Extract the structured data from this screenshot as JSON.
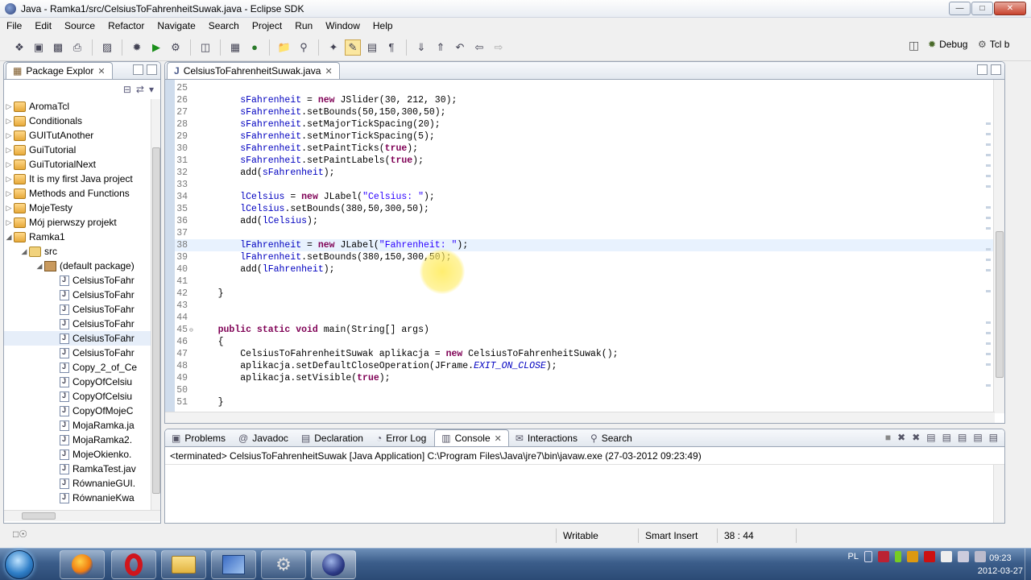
{
  "window": {
    "title": "Java - Ramka1/src/CelsiusToFahrenheitSuwak.java - Eclipse SDK"
  },
  "menu": [
    "File",
    "Edit",
    "Source",
    "Refactor",
    "Navigate",
    "Search",
    "Project",
    "Run",
    "Window",
    "Help"
  ],
  "perspectives": {
    "debug": "Debug",
    "tcl": "Tcl b"
  },
  "package_explorer": {
    "title": "Package Explor",
    "items": [
      {
        "label": "AromaTcl",
        "type": "project",
        "indent": 0
      },
      {
        "label": "Conditionals",
        "type": "project",
        "indent": 0
      },
      {
        "label": "GUITutAnother",
        "type": "project",
        "indent": 0
      },
      {
        "label": "GuiTutorial",
        "type": "project",
        "indent": 0
      },
      {
        "label": "GuiTutorialNext",
        "type": "project",
        "indent": 0
      },
      {
        "label": "It is my first Java project",
        "type": "project",
        "indent": 0
      },
      {
        "label": "Methods and Functions",
        "type": "project",
        "indent": 0
      },
      {
        "label": "MojeTesty",
        "type": "project",
        "indent": 0
      },
      {
        "label": "Mój pierwszy projekt",
        "type": "project",
        "indent": 0
      },
      {
        "label": "Ramka1",
        "type": "project",
        "indent": 0,
        "expanded": true
      },
      {
        "label": "src",
        "type": "src",
        "indent": 1,
        "expanded": true
      },
      {
        "label": "(default package)",
        "type": "package",
        "indent": 2,
        "expanded": true
      },
      {
        "label": "CelsiusToFahr",
        "type": "java",
        "indent": 3
      },
      {
        "label": "CelsiusToFahr",
        "type": "java",
        "indent": 3
      },
      {
        "label": "CelsiusToFahr",
        "type": "java",
        "indent": 3
      },
      {
        "label": "CelsiusToFahr",
        "type": "java",
        "indent": 3
      },
      {
        "label": "CelsiusToFahr",
        "type": "java",
        "indent": 3,
        "selected": true
      },
      {
        "label": "CelsiusToFahr",
        "type": "java",
        "indent": 3
      },
      {
        "label": "Copy_2_of_Ce",
        "type": "java",
        "indent": 3
      },
      {
        "label": "CopyOfCelsiu",
        "type": "java",
        "indent": 3
      },
      {
        "label": "CopyOfCelsiu",
        "type": "java",
        "indent": 3
      },
      {
        "label": "CopyOfMojeC",
        "type": "java",
        "indent": 3
      },
      {
        "label": "MojaRamka.ja",
        "type": "java",
        "indent": 3
      },
      {
        "label": "MojaRamka2.",
        "type": "java",
        "indent": 3
      },
      {
        "label": "MojeOkienko.",
        "type": "java",
        "indent": 3
      },
      {
        "label": "RamkaTest.jav",
        "type": "java",
        "indent": 3
      },
      {
        "label": "RównanieGUI.",
        "type": "java",
        "indent": 3
      },
      {
        "label": "RównanieKwa",
        "type": "java",
        "indent": 3
      }
    ]
  },
  "editor": {
    "tab": "CelsiusToFahrenheitSuwak.java",
    "current_line": 38,
    "lines": [
      {
        "n": "25",
        "tokens": []
      },
      {
        "n": "26",
        "tokens": [
          [
            "",
            "        "
          ],
          [
            "fld",
            "sFahrenheit"
          ],
          [
            "",
            " = "
          ],
          [
            "kw",
            "new"
          ],
          [
            "",
            " JSlider(30, 212, 30);"
          ]
        ]
      },
      {
        "n": "27",
        "tokens": [
          [
            "",
            "        "
          ],
          [
            "fld",
            "sFahrenheit"
          ],
          [
            "",
            ".setBounds(50,150,300,50);"
          ]
        ]
      },
      {
        "n": "28",
        "tokens": [
          [
            "",
            "        "
          ],
          [
            "fld",
            "sFahrenheit"
          ],
          [
            "",
            ".setMajorTickSpacing(20);"
          ]
        ]
      },
      {
        "n": "29",
        "tokens": [
          [
            "",
            "        "
          ],
          [
            "fld",
            "sFahrenheit"
          ],
          [
            "",
            ".setMinorTickSpacing(5);"
          ]
        ]
      },
      {
        "n": "30",
        "tokens": [
          [
            "",
            "        "
          ],
          [
            "fld",
            "sFahrenheit"
          ],
          [
            "",
            ".setPaintTicks("
          ],
          [
            "kw",
            "true"
          ],
          [
            "",
            ");"
          ]
        ]
      },
      {
        "n": "31",
        "tokens": [
          [
            "",
            "        "
          ],
          [
            "fld",
            "sFahrenheit"
          ],
          [
            "",
            ".setPaintLabels("
          ],
          [
            "kw",
            "true"
          ],
          [
            "",
            ");"
          ]
        ]
      },
      {
        "n": "32",
        "tokens": [
          [
            "",
            "        add("
          ],
          [
            "fld",
            "sFahrenheit"
          ],
          [
            "",
            ");"
          ]
        ]
      },
      {
        "n": "33",
        "tokens": []
      },
      {
        "n": "34",
        "tokens": [
          [
            "",
            "        "
          ],
          [
            "fld",
            "lCelsius"
          ],
          [
            "",
            " = "
          ],
          [
            "kw",
            "new"
          ],
          [
            "",
            " JLabel("
          ],
          [
            "str",
            "\"Celsius: \""
          ],
          [
            "",
            ");"
          ]
        ]
      },
      {
        "n": "35",
        "tokens": [
          [
            "",
            "        "
          ],
          [
            "fld",
            "lCelsius"
          ],
          [
            "",
            ".setBounds(380,50,300,50);"
          ]
        ]
      },
      {
        "n": "36",
        "tokens": [
          [
            "",
            "        add("
          ],
          [
            "fld",
            "lCelsius"
          ],
          [
            "",
            ");"
          ]
        ]
      },
      {
        "n": "37",
        "tokens": []
      },
      {
        "n": "38",
        "tokens": [
          [
            "",
            "        "
          ],
          [
            "fld",
            "lFahrenheit"
          ],
          [
            "",
            " = "
          ],
          [
            "kw",
            "new"
          ],
          [
            "",
            " JLabel("
          ],
          [
            "str",
            "\"Fahrenheit: \""
          ],
          [
            "",
            ");"
          ]
        ]
      },
      {
        "n": "39",
        "tokens": [
          [
            "",
            "        "
          ],
          [
            "fld",
            "lFahrenheit"
          ],
          [
            "",
            ".setBounds(380,150,300,50);"
          ]
        ]
      },
      {
        "n": "40",
        "tokens": [
          [
            "",
            "        add("
          ],
          [
            "fld",
            "lFahrenheit"
          ],
          [
            "",
            ");"
          ]
        ]
      },
      {
        "n": "41",
        "tokens": []
      },
      {
        "n": "42",
        "tokens": [
          [
            "",
            "    }"
          ]
        ]
      },
      {
        "n": "43",
        "tokens": []
      },
      {
        "n": "44",
        "tokens": []
      },
      {
        "n": "45",
        "fold": true,
        "tokens": [
          [
            "",
            "    "
          ],
          [
            "kw",
            "public static void"
          ],
          [
            "",
            " main(String[] args)"
          ]
        ]
      },
      {
        "n": "46",
        "tokens": [
          [
            "",
            "    {"
          ]
        ]
      },
      {
        "n": "47",
        "tokens": [
          [
            "",
            "        CelsiusToFahrenheitSuwak aplikacja = "
          ],
          [
            "kw",
            "new"
          ],
          [
            "",
            " CelsiusToFahrenheitSuwak();"
          ]
        ]
      },
      {
        "n": "48",
        "tokens": [
          [
            "",
            "        aplikacja.setDefaultCloseOperation(JFrame."
          ],
          [
            "stat",
            "EXIT_ON_CLOSE"
          ],
          [
            "",
            ");"
          ]
        ]
      },
      {
        "n": "49",
        "tokens": [
          [
            "",
            "        aplikacja.setVisible("
          ],
          [
            "kw",
            "true"
          ],
          [
            "",
            ");"
          ]
        ]
      },
      {
        "n": "50",
        "tokens": []
      },
      {
        "n": "51",
        "tokens": [
          [
            "",
            "    }"
          ]
        ]
      }
    ]
  },
  "bottom_tabs": [
    "Problems",
    "Javadoc",
    "Declaration",
    "Error Log",
    "Console",
    "Interactions",
    "Search"
  ],
  "active_bottom_tab": "Console",
  "console": {
    "header": "<terminated> CelsiusToFahrenheitSuwak [Java Application] C:\\Program Files\\Java\\jre7\\bin\\javaw.exe (27-03-2012 09:23:49)"
  },
  "status": {
    "writable": "Writable",
    "insert_mode": "Smart Insert",
    "position": "38 : 44"
  },
  "taskbar": {
    "language": "PL",
    "time": "09:23",
    "date": "2012-03-27"
  }
}
